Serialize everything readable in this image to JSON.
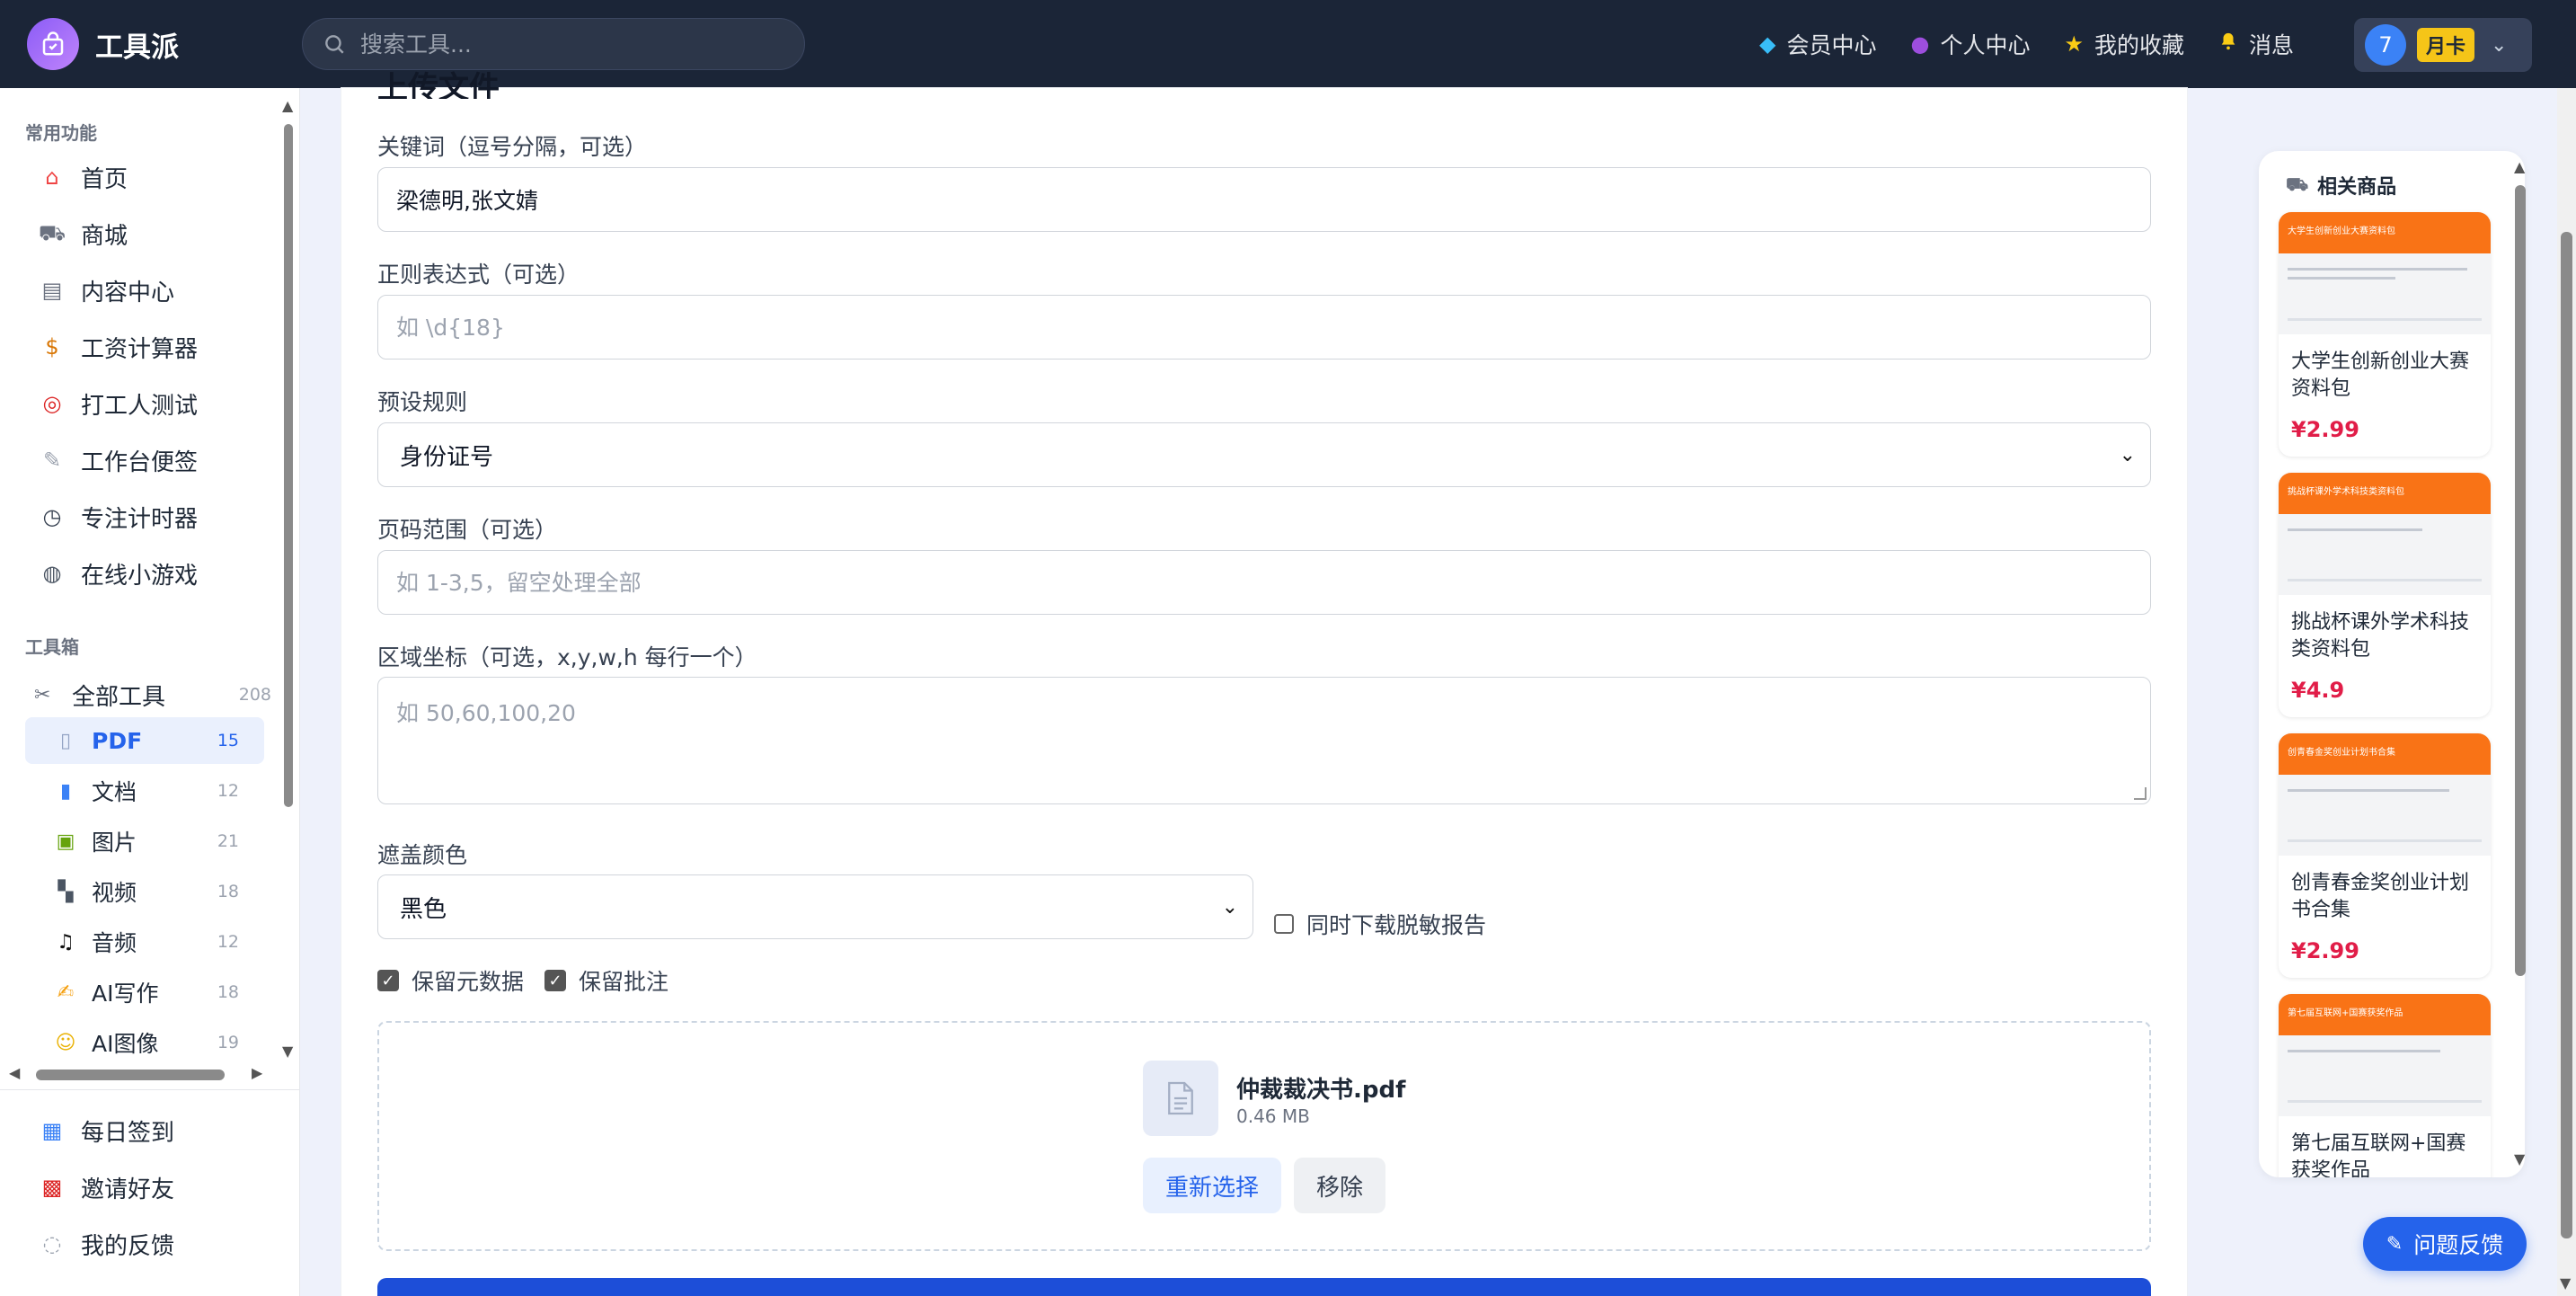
{
  "header": {
    "app_name": "工具派",
    "search_placeholder": "搜索工具...",
    "nav": [
      {
        "label": "会员中心",
        "icon": "diamond-icon"
      },
      {
        "label": "个人中心",
        "icon": "user-icon"
      },
      {
        "label": "我的收藏",
        "icon": "star-icon"
      },
      {
        "label": "消息",
        "icon": "bell-icon"
      }
    ],
    "user_level": "7",
    "user_badge": "月卡"
  },
  "sidebar": {
    "section_common": "常用功能",
    "common": [
      {
        "label": "首页",
        "icon": "home-icon"
      },
      {
        "label": "商城",
        "icon": "cart-icon"
      },
      {
        "label": "内容中心",
        "icon": "news-icon"
      },
      {
        "label": "工资计算器",
        "icon": "money-bag-icon"
      },
      {
        "label": "打工人测试",
        "icon": "target-icon"
      },
      {
        "label": "工作台便签",
        "icon": "memo-icon"
      },
      {
        "label": "专注计时器",
        "icon": "stopwatch-icon"
      },
      {
        "label": "在线小游戏",
        "icon": "gamepad-icon"
      }
    ],
    "section_toolbox": "工具箱",
    "all_tools": {
      "label": "全部工具",
      "count": "208"
    },
    "categories": [
      {
        "label": "PDF",
        "count": "15",
        "icon": "pdf-icon"
      },
      {
        "label": "文档",
        "count": "12",
        "icon": "book-icon"
      },
      {
        "label": "图片",
        "count": "21",
        "icon": "picture-icon"
      },
      {
        "label": "视频",
        "count": "18",
        "icon": "clapper-icon"
      },
      {
        "label": "音频",
        "count": "12",
        "icon": "music-icon"
      },
      {
        "label": "AI写作",
        "count": "18",
        "icon": "writing-icon"
      },
      {
        "label": "AI图像",
        "count": "19",
        "icon": "ai-image-icon"
      }
    ],
    "bottom": [
      {
        "label": "每日签到",
        "icon": "calendar-icon"
      },
      {
        "label": "邀请好友",
        "icon": "gift-icon"
      },
      {
        "label": "我的反馈",
        "icon": "speech-bubble-icon"
      }
    ]
  },
  "form": {
    "section_title": "上传文件",
    "keywords_label": "关键词（逗号分隔，可选）",
    "keywords_value": "梁德明,张文婧",
    "regex_label": "正则表达式（可选）",
    "regex_placeholder": "如 \\d{18}",
    "preset_label": "预设规则",
    "preset_value": "身份证号",
    "pages_label": "页码范围（可选）",
    "pages_placeholder": "如 1-3,5，留空处理全部",
    "region_label": "区域坐标（可选，x,y,w,h 每行一个）",
    "region_placeholder": "如 50,60,100,20",
    "color_label": "遮盖颜色",
    "color_value": "黑色",
    "report_checkbox": "同时下载脱敏报告",
    "keep_metadata": "保留元数据",
    "keep_annotations": "保留批注",
    "file_name": "仲裁裁决书.pdf",
    "file_size": "0.46 MB",
    "reselect_button": "重新选择",
    "remove_button": "移除"
  },
  "related": {
    "title": "相关商品",
    "products": [
      {
        "name": "大学生创新创业大赛资料包",
        "price": "¥2.99",
        "banner": "大学生创新创业大赛资料包"
      },
      {
        "name": "挑战杯课外学术科技类资料包",
        "price": "¥4.9",
        "banner": "挑战杯课外学术科技类资料包"
      },
      {
        "name": "创青春金奖创业计划书合集",
        "price": "¥2.99",
        "banner": "创青春金奖创业计划书合集"
      },
      {
        "name": "第七届互联网+国赛获奖作品",
        "price": "",
        "banner": "第七届互联网+国赛获奖作品"
      }
    ]
  },
  "feedback_button": "问题反馈"
}
